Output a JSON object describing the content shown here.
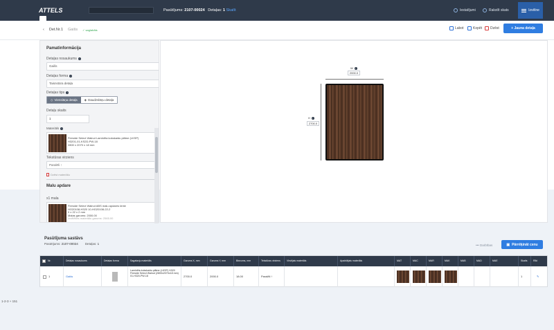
{
  "topbar": {
    "logo": "ATTELS",
    "order_label": "Pasūtījums:",
    "order_number": "2107-00024",
    "details_label": "Detaļas:",
    "details_count": "1",
    "details_link": "Skatīt",
    "settings": "Iestatījumi",
    "contact": "Rakstīt skats",
    "menu": "Izvēlne"
  },
  "breadcrumb": {
    "title": "Det.Nr.1",
    "name": "Gaišs",
    "status": "✓ saglabāts"
  },
  "actions": {
    "copy": "Labot",
    "duplicate": "Kopēt",
    "delete": "Dzēst",
    "new_detail": "+ Jauna detaļa"
  },
  "form": {
    "section_title": "Pamatinformācija",
    "name_label": "Detaļas nosaukums",
    "name_value": "Gaišs",
    "shape_label": "Detaļas forma",
    "shape_value": "Taisnstūra detaļa",
    "type_label": "Detaļas tips",
    "type_options": [
      "Vienslāņa detaļa",
      "Daudzslāņu detaļa"
    ],
    "count_label": "Detaļu skaits",
    "count_value": "1",
    "material_label": "Materiāls",
    "material_lines": [
      "Fireside Select Walnut Laminēta kokskaidu plātne (LKSP)",
      "H3201-01-KS2D-PW-18",
      "2800 x 2070 x 18 mm"
    ],
    "texture_label": "Tekstūras virziens",
    "texture_value": "Paralēli ↑",
    "remove_material": "Dzēst materiālu",
    "edge_title": "Malu apdare",
    "edge_sub": "x1 mala",
    "edge_lines": [
      "Fireside Select Walnut ABS malu apdares lente",
      "HO20108-H320 10-HO20108-22-2",
      "0 x 22 x 2 mm",
      "Malas garums: 2000.00",
      "Izvēlēties materiālu garums: 2565.00"
    ]
  },
  "preview": {
    "width_label": "W",
    "width_value": "2000.0",
    "height_label": "H",
    "height_value": "2700.0"
  },
  "summary": {
    "title": "Pasūtījuma sastāvs",
    "order_label": "Pasūtījums:",
    "order_value": "2107-00024",
    "details_label": "Detaļas:",
    "details_value": "1",
    "link": "••• Darbības",
    "calc_button": "Pārrēķināt cenu"
  },
  "table": {
    "headers": [
      "Nr.",
      "Detaļas nosaukums",
      "Detaļas forma",
      "Sagatavju materiāls",
      "Garums X, mm",
      "Garums Y, mm",
      "Biezums, mm",
      "Tekstūras virziens",
      "Virsējais materiāls",
      "Apakšējais materiāls",
      "MAT",
      "MAC",
      "MAR",
      "MAK",
      "MAB",
      "MAD",
      "MAE",
      "Skaits",
      "Rīki"
    ],
    "row": {
      "nr": "1",
      "name": "Gaišs",
      "material": "Laminēta kokskaidu plātne (LKSP) H320 Fireside Select Walnut (2800x2070x18 mm) 01-H320-PW-18",
      "length_x": "2700.0",
      "length_y": "2000.0",
      "thickness": "18.00",
      "texture": "Paralēli ↑",
      "count": "1"
    }
  },
  "footer": {
    "note": "1-2-3 + 151"
  },
  "colors": {
    "topbar": "#2f3a4a",
    "accent": "#2f7de1",
    "wood": "#5a3a28"
  }
}
